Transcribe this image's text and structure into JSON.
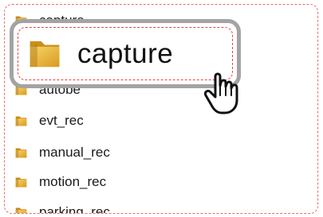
{
  "folder_list": {
    "items": [
      {
        "label": "capture"
      },
      {
        "label": "autobe"
      },
      {
        "label": "evt_rec"
      },
      {
        "label": "manual_rec"
      },
      {
        "label": "motion_rec"
      },
      {
        "label": "parking_rec"
      }
    ]
  },
  "zoom_callout": {
    "label": "capture"
  },
  "icons": {
    "folder": "folder-icon",
    "cursor": "hand-pointer-icon"
  },
  "colors": {
    "folder_yellow": "#e8b632",
    "dashed_outline": "#ec6a6a",
    "zoom_border": "#a3a3a3",
    "zoom_dashed": "#e64444"
  }
}
